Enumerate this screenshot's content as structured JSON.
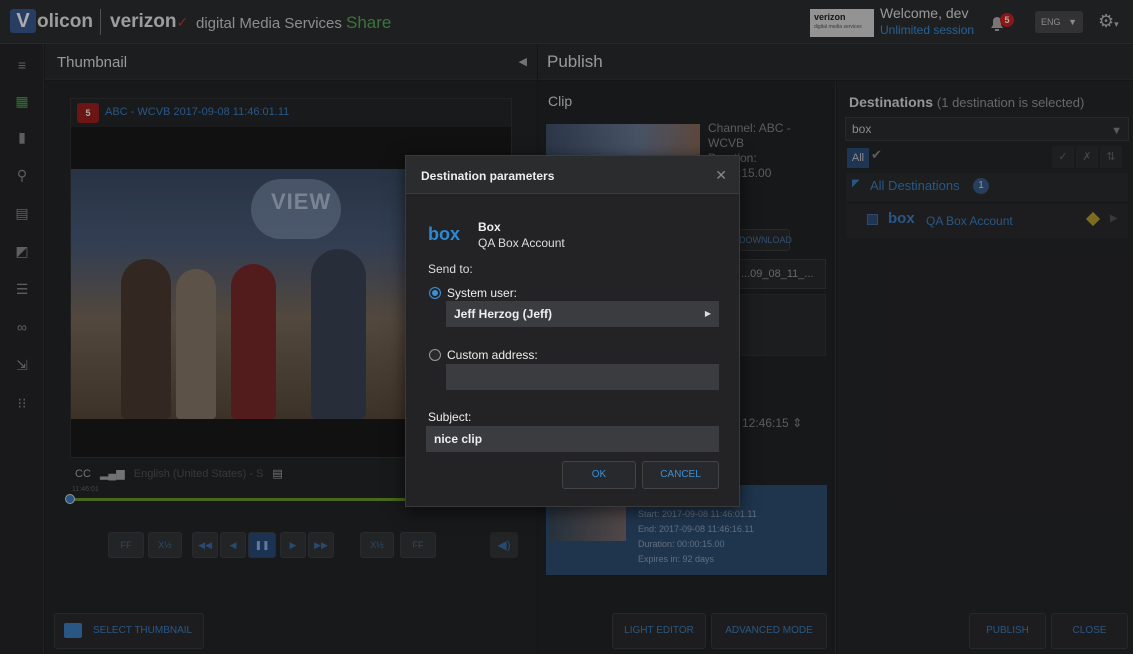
{
  "topbar": {
    "logo_letter": "V",
    "logo_text": "olicon",
    "verizon": "verizon",
    "dms": "digital Media Services",
    "share": "Share",
    "badge_brand": "verizon",
    "badge_sub": "digital media services",
    "welcome": "Welcome, dev",
    "session": "Unlimited session",
    "notifications": "5",
    "language": "ENG"
  },
  "rail": {
    "icons": [
      "menu-icon",
      "film-icon",
      "bookmark-icon",
      "search-icon",
      "grid-icon",
      "media-icon",
      "list-icon",
      "voicemail-icon",
      "export-icon",
      "keypad-icon"
    ]
  },
  "thumbnail": {
    "title": "Thumbnail",
    "channel_logo": "5",
    "channel": "ABC - WCVB  2017-09-08 11:46:01.11",
    "view_logo": "VIEW",
    "cc_label": "CC",
    "caption_lang": "English (United States) - S",
    "time_small": "11:46:01",
    "buttons": {
      "ff_back": "FF",
      "half_back": "X½",
      "half_fwd": "X½",
      "ff_fwd": "FF"
    },
    "select_btn": "SELECT THUMBNAIL"
  },
  "publish": {
    "title": "Publish",
    "clip_title": "Clip",
    "clip_meta": [
      "Channel: ABC -",
      "WCVB",
      "Duration:",
      "00:00:15.00"
    ],
    "download": "DOWNLOAD",
    "filename": "...09_08_11_...",
    "time_value": "12:46:15",
    "card": {
      "start": "Start: 2017-09-08 11:46:01.11",
      "end": "End: 2017-09-08 11:46:16.11",
      "duration": "Duration: 00:00:15.00",
      "expires": "Expires in: 92 days"
    },
    "light_editor": "LIGHT EDITOR",
    "advanced_mode": "ADVANCED MODE",
    "publish_btn": "PUBLISH",
    "close_btn": "CLOSE"
  },
  "destinations": {
    "title": "Destinations",
    "subtitle": "(1 destination is selected)",
    "search_value": "box",
    "all_label": "All",
    "group_label": "All Destinations",
    "group_count": "1",
    "row_logo": "box",
    "row_label": "QA Box Account"
  },
  "modal": {
    "title": "Destination parameters",
    "service_logo": "box",
    "service_name": "Box",
    "account": "QA Box Account",
    "send_to": "Send to:",
    "system_user_label": "System user:",
    "system_user_value": "Jeff Herzog (Jeff)",
    "custom_label": "Custom address:",
    "custom_value": "",
    "subject_label": "Subject:",
    "subject_value": "nice clip",
    "ok": "OK",
    "cancel": "CANCEL"
  },
  "colors": {
    "accent": "#3c8fd4",
    "share_green": "#5aa85a",
    "notification_red": "#cc2222"
  }
}
